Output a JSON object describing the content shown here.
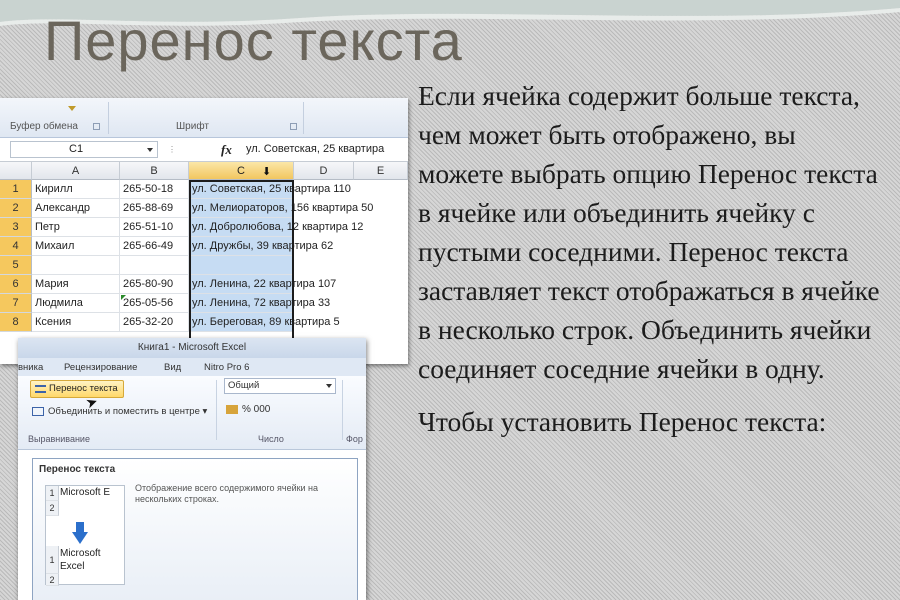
{
  "slide": {
    "title": "Перенос текста",
    "paragraph1": "Если ячейка содержит больше текста, чем может быть отображено, вы можете выбрать опцию Перенос текста в ячейке или объединить ячейку с пустыми соседними. Перенос текста заставляет текст отображаться в ячейке в несколько строк. Объединить ячейки соединяет соседние ячейки в одну.",
    "paragraph2": "Чтобы установить Перенос текста:"
  },
  "excel_grid": {
    "ribbon_groups": [
      "Буфер обмена",
      "Шрифт"
    ],
    "name_box": "C1",
    "fx_label": "fx",
    "formula_value": "ул. Советская, 25 квартира",
    "columns": [
      "A",
      "B",
      "C",
      "D",
      "E"
    ],
    "row_numbers": [
      "1",
      "2",
      "3",
      "4",
      "5",
      "6",
      "7",
      "8"
    ],
    "rows": [
      {
        "a": "Кирилл",
        "b": "265-50-18",
        "c": "ул. Советская, 25 квартира 110"
      },
      {
        "a": "Александр",
        "b": "265-88-69",
        "c": "ул. Мелиораторов, 156 квартира 50"
      },
      {
        "a": "Петр",
        "b": "265-51-10",
        "c": "ул. Добролюбова, 12 квартира 12"
      },
      {
        "a": "Михаил",
        "b": "265-66-49",
        "c": "ул. Дружбы, 39 квартира 62"
      },
      {
        "a": "",
        "b": "",
        "c": ""
      },
      {
        "a": "Мария",
        "b": "265-80-90",
        "c": "ул. Ленина, 22 квартира 107"
      },
      {
        "a": "Людмила",
        "b": "265-05-56",
        "c": "ул. Ленина, 72 квартира 33"
      },
      {
        "a": "Ксения",
        "b": "265-32-20",
        "c": "ул. Береговая, 89 квартира 5"
      }
    ]
  },
  "excel_ribbon": {
    "window_title": "Книга1 - Microsoft Excel",
    "tabs": [
      "вника",
      "Рецензирование",
      "Вид",
      "Nitro Pro 6"
    ],
    "wrap_text_button": "Перенос текста",
    "merge_button": "Объединить и поместить в центре",
    "group_alignment": "Выравнивание",
    "group_number": "Число",
    "number_format": "Общий",
    "number_row": "% 000",
    "group_styles_partial": "Фор",
    "tooltip": {
      "title": "Перенос текста",
      "description": "Отображение всего содержимого ячейки на нескольких строках.",
      "example_before": "Microsoft E",
      "example_after_line1": "Microsoft",
      "example_after_line2": "Excel",
      "row1": "1",
      "row2": "2"
    }
  },
  "colors": {
    "selected_column": "#c6dcf3",
    "header_highlight": "#f5c85e",
    "title_text": "#6b665c"
  }
}
